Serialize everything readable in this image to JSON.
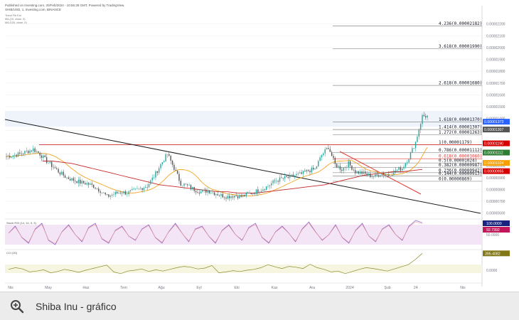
{
  "header": {
    "line1": "Published on Investing.com, 20/Feb/2024 - 10:56:28 GMT, Powered by TradingView.",
    "line2": "SHIB/USD, 1, Investing.com, BINANCE",
    "line3": "Trend Fib Ext",
    "line4": "MA (20, close, 0)",
    "line5": "MA (100, close, 0)"
  },
  "caption": {
    "title": "Shiba Inu - gráfico",
    "zoom_icon": "magnifier-plus-icon"
  },
  "colors": {
    "candle_up": "#26a69a",
    "candle_down": "#555555",
    "ma_short": "#f5a623",
    "ma_long": "#c62828",
    "fib_line": "#8c8c8c",
    "fib_red": "#e53935",
    "rsi_line": "#7e57c2",
    "rsi_band": "#f3e5f5",
    "osc_line": "#8a8a2e",
    "price_badge_blue": "#2962ff",
    "price_badge_red": "#d50000",
    "price_badge_orange": "#f59f00",
    "price_badge_green": "#2e7d32"
  },
  "chart_data": {
    "type": "candlestick",
    "series": [
      {
        "name": "SHIB/USD",
        "note": "approximate daily closes read from chart"
      },
      {
        "name": "MA (20, close, 0)"
      },
      {
        "name": "MA (100, close, 0)"
      }
    ],
    "x_ticks": [
      "Nis",
      "May",
      "Haz",
      "Tem",
      "Ağu",
      "Eyl",
      "Eki",
      "Kas",
      "Ara",
      "2024",
      "Şub",
      "24",
      "Nis"
    ],
    "x_tick_months": [
      0,
      1,
      2,
      3,
      4,
      5,
      6,
      7,
      8,
      9,
      10,
      10.75,
      12
    ],
    "closes": [
      1.08e-05,
      1.09e-05,
      1.1e-05,
      1.12e-05,
      1.14e-05,
      1.1e-05,
      1.04e-05,
      9.9e-06,
      9.4e-06,
      9e-06,
      8.8e-06,
      8.6e-06,
      8.5e-06,
      8.3e-06,
      7.9e-06,
      7.4e-06,
      7.6e-06,
      7.8e-06,
      7.7e-06,
      7.9e-06,
      8.1e-06,
      8.3e-06,
      9.1e-06,
      1.01e-05,
      1.1e-05,
      9.8e-06,
      8.5e-06,
      8.3e-06,
      8e-06,
      7.8e-06,
      7.9e-06,
      7.7e-06,
      7.5e-06,
      7.4e-06,
      7.5e-06,
      7.4e-06,
      7.6e-06,
      7.8e-06,
      8e-06,
      8.3e-06,
      8.7e-06,
      8.9e-06,
      9e-06,
      9.2e-06,
      9.3e-06,
      9.6e-06,
      9.7e-06,
      1.09e-05,
      1.16e-05,
      1.01e-05,
      9.7e-06,
      1.02e-05,
      9.5e-06,
      9.4e-06,
      9.2e-06,
      9.1e-06,
      9.4e-06,
      9.2e-06,
      9.6e-06,
      9.8e-06,
      1.07e-05,
      1.2e-05,
      1.42e-05
    ],
    "ma100": [
      1.04e-05,
      1.04e-05,
      1.03e-05,
      1.02e-05,
      1e-05,
      9.8e-06,
      9.6e-06,
      9.4e-06,
      9.2e-06,
      9e-06,
      8.8e-06,
      8.6e-06,
      8.4e-06,
      8.3e-06,
      8.2e-06,
      8.1e-06,
      8e-06,
      7.9e-06,
      7.8e-06,
      7.8e-06,
      7.7e-06,
      7.7e-06,
      7.7e-06,
      7.8e-06,
      7.9e-06,
      8e-06,
      8.1e-06,
      8.2e-06,
      8.3e-06,
      8.4e-06,
      8.6e-06,
      8.8e-06,
      9e-06,
      9.2e-06,
      9.3e-06,
      9.4e-06,
      9.5e-06,
      9.5e-06,
      9.6e-06,
      9.7e-06
    ],
    "y_axis_labels": [
      "0.00002200",
      "0.00002100",
      "0.00002000",
      "0.00001900",
      "0.00001800",
      "0.00001700",
      "0.00001600",
      "0.00001500",
      "0.00001400",
      "0.00001300",
      "0.00001200",
      "0.00001100",
      "0.00001000",
      "0.00000900",
      "0.00000800",
      "0.00000700",
      "0.00000600"
    ],
    "y_axis_values": [
      2.2e-05,
      2.1e-05,
      2e-05,
      1.9e-05,
      1.8e-05,
      1.7e-05,
      1.6e-05,
      1.5e-05,
      1.4e-05,
      1.3e-05,
      1.2e-05,
      1.1e-05,
      1e-05,
      9e-06,
      8e-06,
      7e-06,
      6e-06
    ],
    "ylim": [
      5.8e-06,
      2.27e-05
    ],
    "fib_levels": [
      {
        "label": "4.236(0.00002182)",
        "value": 2.182e-05
      },
      {
        "label": "3.618(0.00001990)",
        "value": 1.99e-05
      },
      {
        "label": "2.618(0.00001680)",
        "value": 1.68e-05
      },
      {
        "label": "1.618(0.00001370)",
        "value": 1.37e-05
      },
      {
        "label": "1.414(0.00001307)",
        "value": 1.307e-05
      },
      {
        "label": "1.272(0.00001263)",
        "value": 1.263e-05
      },
      {
        "label": "1(0.00001179)",
        "value": 1.179e-05
      },
      {
        "label": "0.786(0.00001112)",
        "value": 1.112e-05
      },
      {
        "label": "0.618(0.00001060)",
        "value": 1.06e-05
      },
      {
        "label": "0.5(0.00001024)",
        "value": 1.024e-05
      },
      {
        "label": "0.382(0.00000987)",
        "value": 9.87e-06
      },
      {
        "label": "0.236(0.00000942)",
        "value": 9.42e-06
      },
      {
        "label": "0.144(0.00000913)",
        "value": 9.13e-06
      },
      {
        "label": "0(0.00000869)",
        "value": 8.69e-06
      }
    ],
    "price_badges": [
      {
        "text": "0.00001373",
        "value": 1.373e-05,
        "color": "#2962ff"
      },
      {
        "text": "0.00001307",
        "value": 1.307e-05,
        "color": "#555555"
      },
      {
        "text": "0.00001190",
        "value": 1.19e-05,
        "color": "#d50000"
      },
      {
        "text": "0.00001112",
        "value": 1.112e-05,
        "color": "#2e7d32"
      },
      {
        "text": "0.00001024",
        "value": 1.024e-05,
        "color": "#f59f00"
      },
      {
        "text": "0.00000955",
        "value": 9.55e-06,
        "color": "#d50000"
      }
    ],
    "rsi": {
      "label": "Stoch RSI (14, 14, 3, 3)",
      "badge_top": "100.0000",
      "badge_second": "92.7392",
      "level_text": "50.0000",
      "values": [
        55,
        80,
        40,
        20,
        70,
        90,
        30,
        15,
        60,
        85,
        50,
        25,
        75,
        90,
        35,
        20,
        65,
        80,
        45,
        30,
        70,
        85,
        40,
        20,
        60,
        90,
        55,
        25,
        70,
        80,
        45,
        20,
        65,
        85,
        50,
        30,
        75,
        90,
        40,
        20,
        60,
        80,
        55,
        25,
        70,
        95,
        60,
        30,
        50,
        85,
        40,
        20,
        65,
        90,
        45,
        25,
        70,
        85,
        50,
        30,
        80,
        100,
        92
      ]
    },
    "oscillator": {
      "label": "CCI (20)",
      "badge": "395.4082",
      "level_text": "0.0000",
      "values": [
        20,
        60,
        30,
        -40,
        -20,
        10,
        -60,
        -30,
        20,
        -10,
        -50,
        0,
        40,
        80,
        120,
        -40,
        -80,
        -20,
        0,
        30,
        -30,
        10,
        -20,
        20,
        60,
        90,
        70,
        30,
        50,
        110,
        -60,
        -40,
        -10,
        -30,
        0,
        20,
        60,
        130,
        80,
        40,
        90,
        70,
        40,
        140,
        60,
        20,
        -40,
        -20,
        -80,
        -30,
        20,
        60,
        40,
        10,
        -20,
        30,
        80,
        130,
        250,
        395
      ]
    }
  }
}
